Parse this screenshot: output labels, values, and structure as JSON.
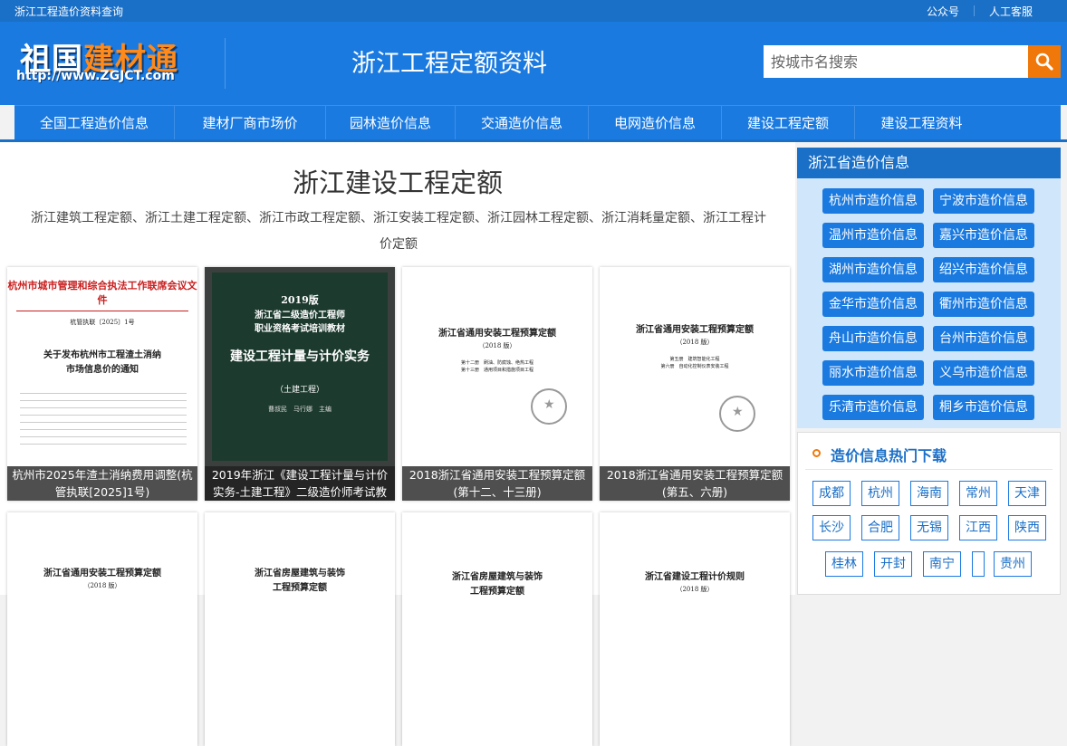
{
  "topbar": {
    "site": "浙江工程造价资料查询",
    "links": [
      "公众号",
      "人工客服"
    ]
  },
  "header": {
    "logo_main_a": "祖国",
    "logo_main_b": "建材通",
    "logo_url": "http://www.ZGJCT.com",
    "page_heading": "浙江工程定额资料",
    "search_placeholder": "按城市名搜索"
  },
  "nav": [
    "全国工程造价信息",
    "建材厂商市场价",
    "园林造价信息",
    "交通造价信息",
    "电网造价信息",
    "建设工程定额",
    "建设工程资料"
  ],
  "main": {
    "title": "浙江建设工程定额",
    "desc": "浙江建筑工程定额、浙江土建工程定额、浙江市政工程定额、浙江安装工程定额、浙江园林工程定额、浙江消耗量定额、浙江工程计价定额",
    "cards": [
      {
        "caption": "杭州市2025年渣土消纳费用调整(杭管执联[2025]1号)",
        "cover_lines": [
          "杭州市城市管理和综合执法工作联席会议文件",
          "杭管执联〔2025〕1号",
          "关于发布杭州市工程渣土消纳",
          "市场信息价的通知"
        ]
      },
      {
        "caption": "2019年浙江《建设工程计量与计价实务-土建工程》二级造价师考试教材",
        "cover_lines": [
          "2019版",
          "浙江省二级造价工程师",
          "职业资格考试培训教材",
          "建设工程计量与计价实务",
          "（土建工程）",
          "曹叔民　马行娜　主编"
        ]
      },
      {
        "caption": "2018浙江省通用安装工程预算定额(第十二、十三册)",
        "cover_lines": [
          "浙江省通用安装工程预算定额",
          "（2018 版）",
          "第十二册　刷油、防腐蚀、绝热工程",
          "第十三册　通用项目和措施项目工程"
        ]
      },
      {
        "caption": "2018浙江省通用安装工程预算定额(第五、六册)",
        "cover_lines": [
          "浙江省通用安装工程预算定额",
          "（2018 版）",
          "第五册　建筑智能化工程",
          "第六册　自动化控制仪表安装工程"
        ]
      },
      {
        "caption": "",
        "cover_lines": [
          "浙江省通用安装工程预算定额",
          "（2018 版）"
        ]
      },
      {
        "caption": "",
        "cover_lines": [
          "浙江省房屋建筑与装饰",
          "工程预算定额"
        ]
      },
      {
        "caption": "",
        "cover_lines": [
          "浙江省房屋建筑与装饰",
          "工程预算定额"
        ]
      },
      {
        "caption": "",
        "cover_lines": [
          "浙江省建设工程计价规则",
          "（2018 版）"
        ]
      }
    ]
  },
  "sidebar": {
    "title": "浙江省造价信息",
    "cities": [
      "杭州市造价信息",
      "宁波市造价信息",
      "温州市造价信息",
      "嘉兴市造价信息",
      "湖州市造价信息",
      "绍兴市造价信息",
      "金华市造价信息",
      "衢州市造价信息",
      "舟山市造价信息",
      "台州市造价信息",
      "丽水市造价信息",
      "义乌市造价信息",
      "乐清市造价信息",
      "桐乡市造价信息"
    ],
    "hot_title": "造价信息热门下载",
    "hot_tags": [
      "成都",
      "杭州",
      "海南",
      "常州",
      "天津",
      "长沙",
      "合肥",
      "无锡",
      "江西",
      "陕西",
      "桂林",
      "开封",
      "南宁",
      "",
      "贵州"
    ]
  },
  "colors": {
    "primary": "#1a7ae0",
    "accent": "#f0780a"
  }
}
